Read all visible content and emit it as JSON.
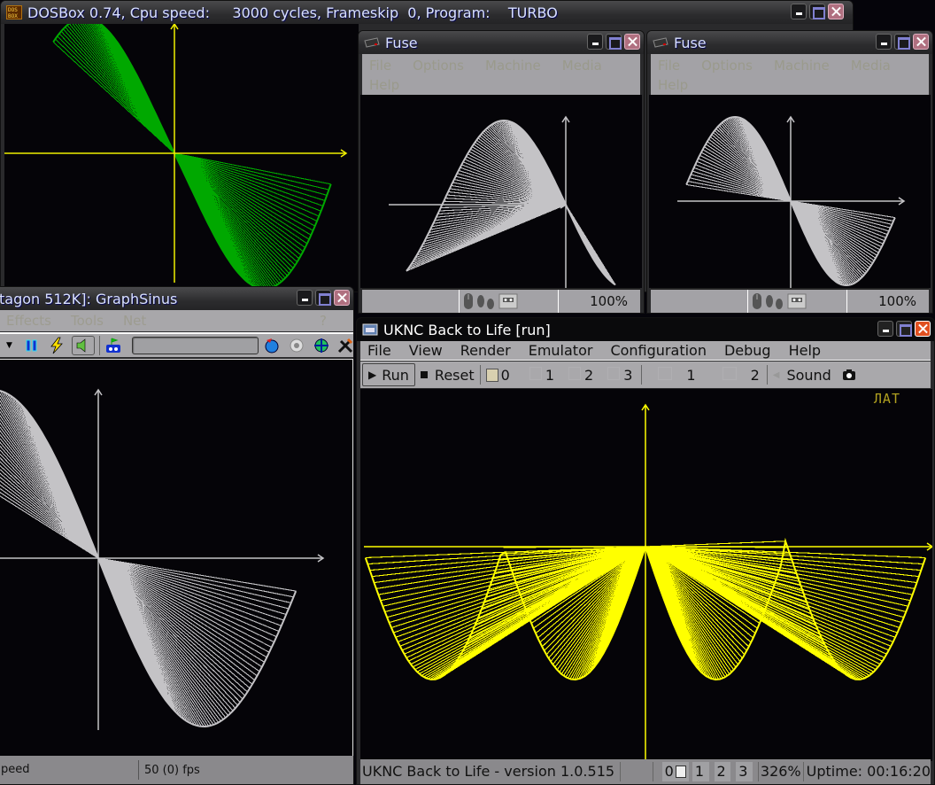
{
  "windows": {
    "dosbox": {
      "title": "DOSBox 0.74, Cpu speed:     3000 cycles, Frameskip  0, Program:    TURBO",
      "plot_color": "#00a800",
      "axis_color": "#f0f000"
    },
    "fuse_left": {
      "title": "Fuse",
      "menu": [
        "File",
        "Options",
        "Machine",
        "Media",
        "Help"
      ],
      "zoom": "100%",
      "plot_color": "#c4c3c6"
    },
    "fuse_right": {
      "title": "Fuse",
      "menu": [
        "File",
        "Options",
        "Machine",
        "Media",
        "Help"
      ],
      "zoom": "100%",
      "plot_color": "#c4c3c6"
    },
    "pentagon": {
      "title": "tagon 512K]: GraphSinus",
      "menu": [
        "Effects",
        "Tools",
        "Net",
        "?"
      ],
      "status_left": "peed",
      "status_fps": "50 (0) fps",
      "plot_color": "#c4c3c6"
    },
    "uknc": {
      "title": "UKNC Back to Life [run]",
      "menu": [
        "File",
        "View",
        "Render",
        "Emulator",
        "Configuration",
        "Debug",
        "Help"
      ],
      "toolbar": {
        "run": "Run",
        "reset": "Reset",
        "drives": [
          "0",
          "1",
          "2",
          "3"
        ],
        "hdds": [
          "1",
          "2"
        ],
        "sound": "Sound"
      },
      "indicator": "ЛАТ",
      "status": {
        "version": "UKNC Back to Life - version 1.0.515",
        "drives": [
          "0",
          "1",
          "2",
          "3"
        ],
        "speed": "326%",
        "uptime": "Uptime: 00:16:20"
      },
      "plot_color": "#ffff00"
    }
  }
}
